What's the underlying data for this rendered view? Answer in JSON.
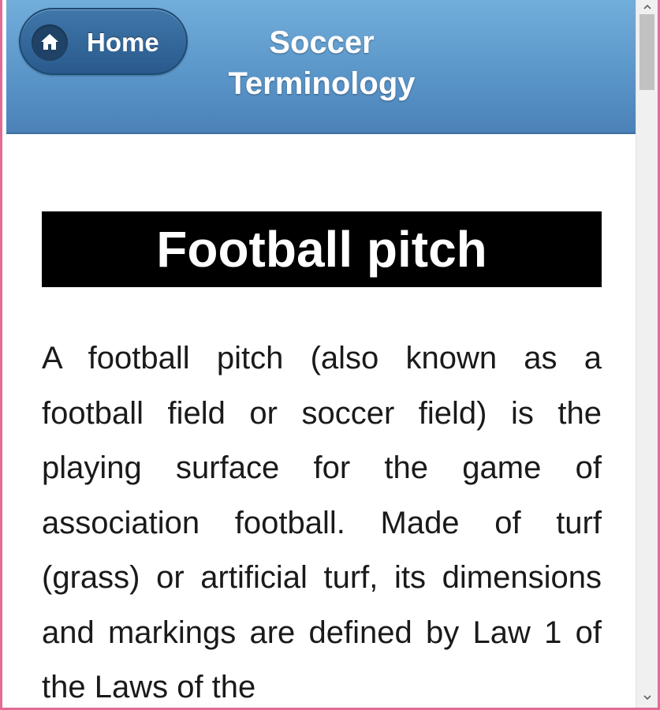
{
  "header": {
    "home_label": "Home",
    "title": "Soccer Terminology",
    "background_color": "#5b96c9"
  },
  "article": {
    "heading": "Football pitch",
    "body": "A football pitch (also known as a football field or soccer field) is the playing surface for the game of association football. Made of turf (grass) or artificial turf, its dimensions and markings are defined by Law 1 of the Laws of the"
  },
  "icons": {
    "home": "home-icon",
    "scroll_up": "chevron-up-icon",
    "scroll_down": "chevron-down-icon"
  },
  "colors": {
    "frame_border": "#e26a94",
    "heading_background": "#000000",
    "heading_text": "#ffffff"
  }
}
